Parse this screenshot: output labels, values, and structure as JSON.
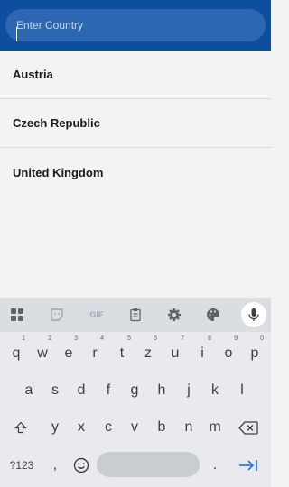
{
  "search": {
    "placeholder": "Enter Country",
    "value": ""
  },
  "countries": [
    "Austria",
    "Czech Republic",
    "United Kingdom"
  ],
  "keyboard": {
    "toolbar": [
      "apps-grid-icon",
      "sticker-icon",
      "gif-icon",
      "clipboard-icon",
      "settings-icon",
      "palette-icon",
      "mic-icon"
    ],
    "gif_label": "GIF",
    "row1": [
      {
        "k": "q",
        "n": "1"
      },
      {
        "k": "w",
        "n": "2"
      },
      {
        "k": "e",
        "n": "3"
      },
      {
        "k": "r",
        "n": "4"
      },
      {
        "k": "t",
        "n": "5"
      },
      {
        "k": "z",
        "n": "6"
      },
      {
        "k": "u",
        "n": "7"
      },
      {
        "k": "i",
        "n": "8"
      },
      {
        "k": "o",
        "n": "9"
      },
      {
        "k": "p",
        "n": "0"
      }
    ],
    "row2": [
      "a",
      "s",
      "d",
      "f",
      "g",
      "h",
      "j",
      "k",
      "l"
    ],
    "row3": [
      "y",
      "x",
      "c",
      "v",
      "b",
      "n",
      "m"
    ],
    "symbols_label": "?123",
    "comma": ",",
    "period": "."
  },
  "colors": {
    "accent": "#0e4e9e",
    "search_bg": "#2e67b1",
    "action_key": "#1a73e8"
  }
}
